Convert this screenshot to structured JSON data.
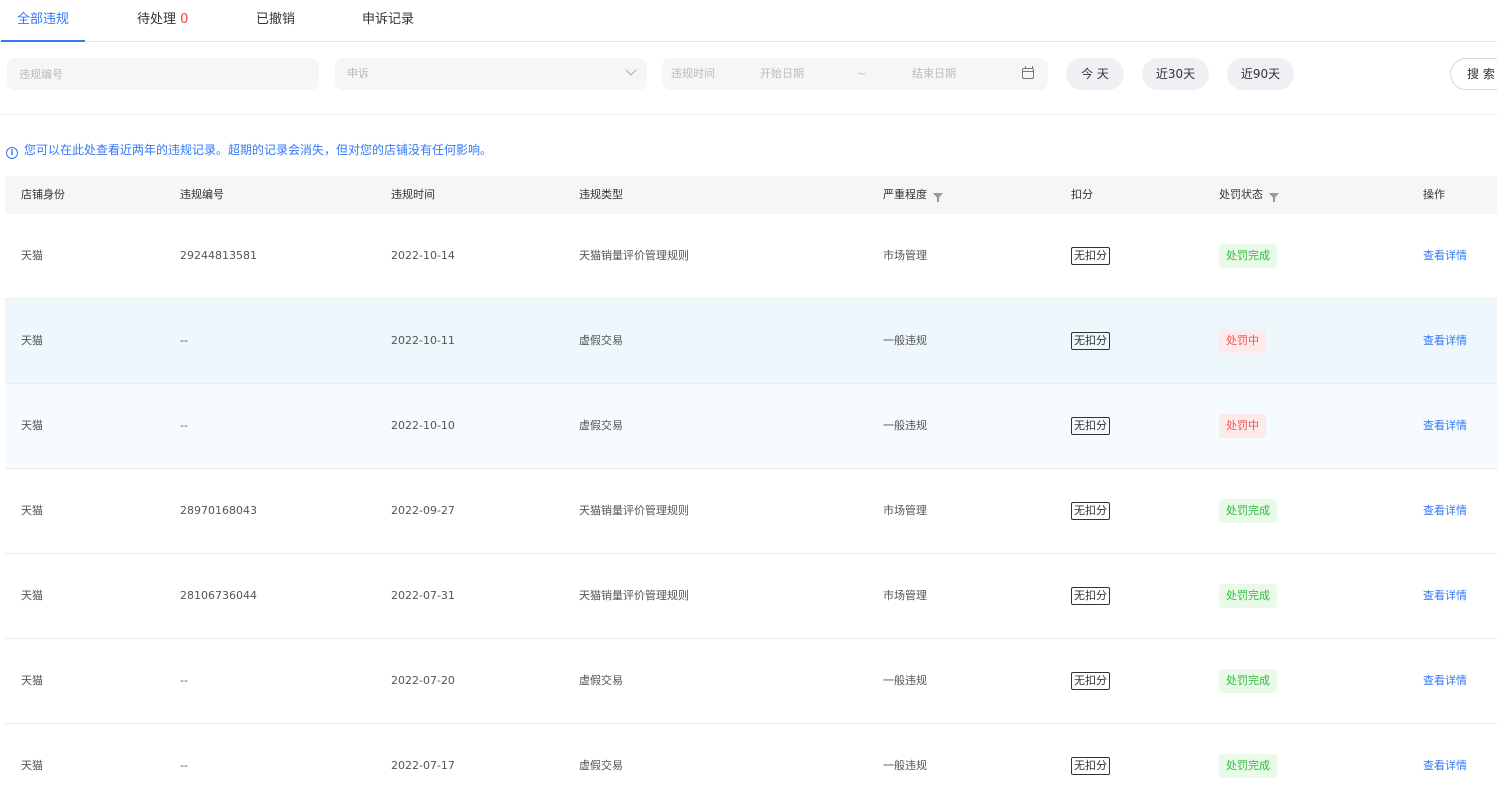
{
  "tabs": [
    {
      "label": "全部违规",
      "count": ""
    },
    {
      "label": "待处理",
      "count": "0"
    },
    {
      "label": "已撤销",
      "count": ""
    },
    {
      "label": "申诉记录",
      "count": ""
    }
  ],
  "filters": {
    "violation_id_placeholder": "违规编号",
    "appeal_select_value": "申诉",
    "date_label": "违规时间",
    "start_date_placeholder": "开始日期",
    "tilde": "~",
    "end_date_placeholder": "结束日期",
    "quick_today": "今 天",
    "quick_30": "近30天",
    "quick_90": "近90天",
    "search_label": "搜 索"
  },
  "notice": {
    "icon": "i",
    "text": "您可以在此处查看近两年的违规记录。超期的记录会消失，但对您的店铺没有任何影响。"
  },
  "table": {
    "headers": {
      "shop_identity": "店铺身份",
      "violation_id": "违规编号",
      "violation_time": "违规时间",
      "violation_type": "违规类型",
      "severity": "严重程度",
      "deduction": "扣分",
      "penalty_status": "处罚状态",
      "action": "操作"
    },
    "rows": [
      {
        "shop": "天猫",
        "id": "29244813581",
        "time": "2022-10-14",
        "type": "天猫销量评价管理规则",
        "severity": "市场管理",
        "deduction": "无扣分",
        "status": "处罚完成",
        "action": "查看详情"
      },
      {
        "shop": "天猫",
        "id": "--",
        "time": "2022-10-11",
        "type": "虚假交易",
        "severity": "一般违规",
        "deduction": "无扣分",
        "status": "处罚中",
        "action": "查看详情"
      },
      {
        "shop": "天猫",
        "id": "--",
        "time": "2022-10-10",
        "type": "虚假交易",
        "severity": "一般违规",
        "deduction": "无扣分",
        "status": "处罚中",
        "action": "查看详情"
      },
      {
        "shop": "天猫",
        "id": "28970168043",
        "time": "2022-09-27",
        "type": "天猫销量评价管理规则",
        "severity": "市场管理",
        "deduction": "无扣分",
        "status": "处罚完成",
        "action": "查看详情"
      },
      {
        "shop": "天猫",
        "id": "28106736044",
        "time": "2022-07-31",
        "type": "天猫销量评价管理规则",
        "severity": "市场管理",
        "deduction": "无扣分",
        "status": "处罚完成",
        "action": "查看详情"
      },
      {
        "shop": "天猫",
        "id": "--",
        "time": "2022-07-20",
        "type": "虚假交易",
        "severity": "一般违规",
        "deduction": "无扣分",
        "status": "处罚完成",
        "action": "查看详情"
      },
      {
        "shop": "天猫",
        "id": "--",
        "time": "2022-07-17",
        "type": "虚假交易",
        "severity": "一般违规",
        "deduction": "无扣分",
        "status": "处罚完成",
        "action": "查看详情"
      }
    ]
  },
  "colors": {
    "accent": "#3478f6",
    "count_red": "#ff3b30",
    "status_done_text": "#2cbb3c",
    "status_done_bg": "#e9fae9",
    "status_doing_text": "#f0524f",
    "status_doing_bg": "#fdeaea"
  }
}
